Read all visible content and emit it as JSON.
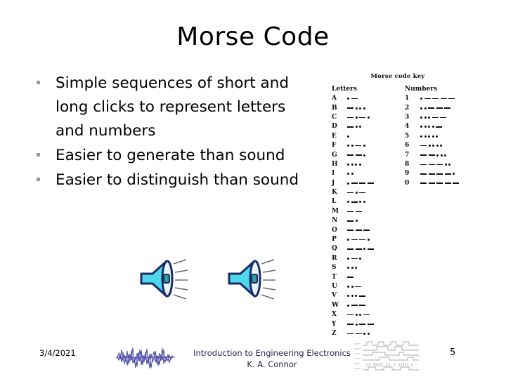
{
  "slide": {
    "title": "Morse Code",
    "page_number": "5"
  },
  "bullets": [
    {
      "text": "Simple sequences of short and long clicks to represent letters and numbers"
    },
    {
      "text": "Easier to generate than sound"
    },
    {
      "text": "Easier to distinguish than sound"
    }
  ],
  "morse_key": {
    "title": "Morse code key",
    "letters_heading": "Letters",
    "numbers_heading": "Numbers",
    "letters": [
      {
        "symbol": "A",
        "code": ".-"
      },
      {
        "symbol": "B",
        "code": "-..."
      },
      {
        "symbol": "C",
        "code": "-.-."
      },
      {
        "symbol": "D",
        "code": "-.."
      },
      {
        "symbol": "E",
        "code": "."
      },
      {
        "symbol": "F",
        "code": "..-."
      },
      {
        "symbol": "G",
        "code": "--."
      },
      {
        "symbol": "H",
        "code": "...."
      },
      {
        "symbol": "I",
        "code": ".."
      },
      {
        "symbol": "J",
        "code": ".---"
      },
      {
        "symbol": "K",
        "code": "-.-"
      },
      {
        "symbol": "L",
        "code": ".-.."
      },
      {
        "symbol": "M",
        "code": "--"
      },
      {
        "symbol": "N",
        "code": "-."
      },
      {
        "symbol": "O",
        "code": "---"
      },
      {
        "symbol": "P",
        "code": ".--."
      },
      {
        "symbol": "Q",
        "code": "--.-"
      },
      {
        "symbol": "R",
        "code": ".-."
      },
      {
        "symbol": "S",
        "code": "..."
      },
      {
        "symbol": "T",
        "code": "-"
      },
      {
        "symbol": "U",
        "code": "..-"
      },
      {
        "symbol": "V",
        "code": "...-"
      },
      {
        "symbol": "W",
        "code": ".--"
      },
      {
        "symbol": "X",
        "code": "-..-"
      },
      {
        "symbol": "Y",
        "code": "-.--"
      },
      {
        "symbol": "Z",
        "code": "--.."
      }
    ],
    "numbers": [
      {
        "symbol": "1",
        "code": ".----"
      },
      {
        "symbol": "2",
        "code": "..---"
      },
      {
        "symbol": "3",
        "code": "...--"
      },
      {
        "symbol": "4",
        "code": "....-"
      },
      {
        "symbol": "5",
        "code": "....."
      },
      {
        "symbol": "6",
        "code": "-...."
      },
      {
        "symbol": "7",
        "code": "--..."
      },
      {
        "symbol": "8",
        "code": "---.."
      },
      {
        "symbol": "9",
        "code": "----."
      },
      {
        "symbol": "0",
        "code": "-----"
      }
    ]
  },
  "icons": {
    "speaker_1": "speaker-sound-icon",
    "speaker_2": "speaker-sound-icon",
    "waveform": "noise-waveform-graphic",
    "timing": "digital-timing-diagram-graphic"
  },
  "footer": {
    "date": "3/4/2021",
    "course": "Introduction to Engineering Electronics",
    "author": "K. A. Connor"
  },
  "colors": {
    "speaker_body": "#4FD8E8",
    "speaker_outline": "#1B2A6B",
    "speaker_center": "#2E9E96",
    "waveform": "#4b4ba8",
    "footer_text": "#24244e",
    "bullet_marker": "#9a9a9a",
    "timing_line": "#9a9a9a"
  }
}
